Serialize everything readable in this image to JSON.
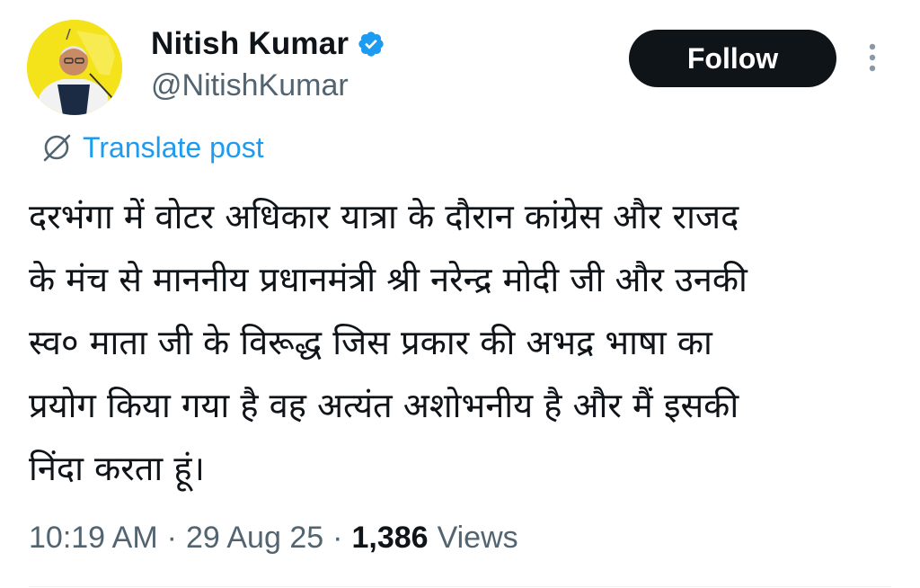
{
  "author": {
    "display_name": "Nitish Kumar",
    "handle": "@NitishKumar",
    "verified_icon": "verified-badge-icon",
    "verified_color": "#1d9bf0"
  },
  "actions": {
    "follow_label": "Follow",
    "more_icon": "more-vertical-icon"
  },
  "translate": {
    "icon": "globe-slash-icon",
    "label": "Translate post"
  },
  "post": {
    "text": "दरभंगा में वोटर अधिकार यात्रा के दौरान कांग्रेस और राजद\nके मंच से माननीय प्रधानमंत्री श्री नरेन्द्र मोदी जी और उनकी\nस्व० माता जी के विरूद्ध जिस प्रकार की अभद्र भाषा का\nप्रयोग किया गया है वह अत्यंत अशोभनीय है और मैं इसकी\nनिंदा करता हूं।"
  },
  "meta": {
    "time": "10:19 AM",
    "separator": "·",
    "date": "29 Aug 25",
    "views_count": "1,386",
    "views_label": "Views"
  },
  "colors": {
    "accent": "#1d9bf0",
    "text_primary": "#0f1419",
    "text_secondary": "#536471",
    "button_bg": "#0f1419",
    "avatar_bg": "#f4e21a"
  }
}
